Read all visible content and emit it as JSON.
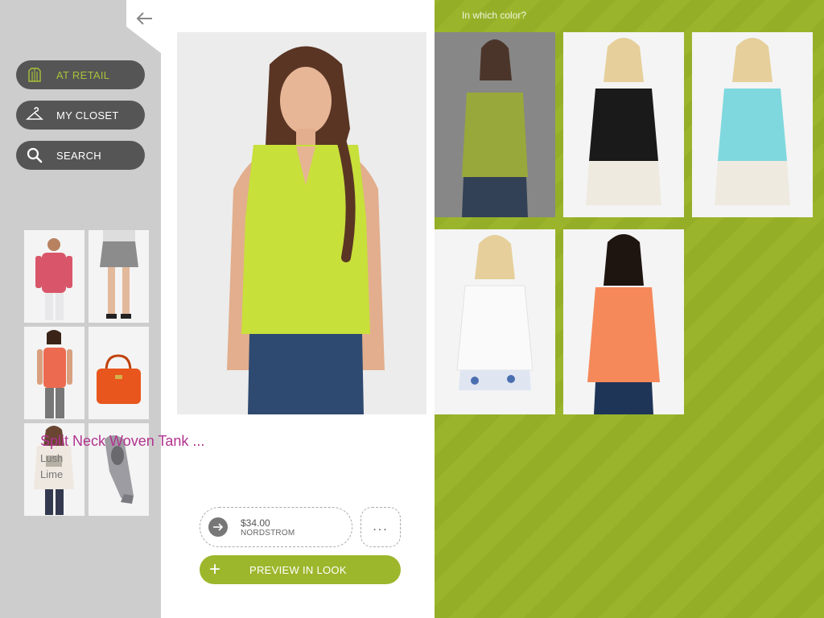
{
  "nav": {
    "back_icon": "arrow-left-icon",
    "items": [
      {
        "label": "AT RETAIL",
        "icon": "store-icon",
        "active": true
      },
      {
        "label": "MY CLOSET",
        "icon": "hanger-icon",
        "active": false
      },
      {
        "label": "SEARCH",
        "icon": "search-icon",
        "active": false
      }
    ]
  },
  "sidebar_thumbs": [
    {
      "item": "pink jacket",
      "color": "#d9566a"
    },
    {
      "item": "grey mini skirt",
      "color": "#8c8c8c"
    },
    {
      "item": "coral tank",
      "color": "#ec6a4f"
    },
    {
      "item": "orange handbag",
      "color": "#e8561d"
    },
    {
      "item": "white peasant blouse",
      "color": "#efe8e0"
    },
    {
      "item": "glitter wedge",
      "color": "#9c9ca2"
    }
  ],
  "product": {
    "title": "Split Neck Woven Tank ...",
    "brand": "Lush",
    "color": "Lime",
    "price": "$34.00",
    "store": "NORDSTROM",
    "more_label": "...",
    "preview_label": "PREVIEW IN LOOK",
    "hero_color": "#c8e03a"
  },
  "color_picker": {
    "title": "In which color?",
    "options": [
      {
        "name": "lime",
        "top": "#c5dd36",
        "bottom": "#2f4a70",
        "selected": true
      },
      {
        "name": "black",
        "top": "#1a1a1a",
        "bottom": "#eeeae0",
        "selected": false
      },
      {
        "name": "aqua",
        "top": "#7fd8de",
        "bottom": "#eeeae0",
        "selected": false
      },
      {
        "name": "white",
        "top": "#fafafa",
        "bottom": "#dfe6f2",
        "selected": false
      },
      {
        "name": "coral",
        "top": "#f5895a",
        "bottom": "#1f3558",
        "selected": false
      }
    ]
  },
  "colors": {
    "accent_green": "#9cb72c",
    "title_magenta": "#b2338f",
    "sidebar_grey": "#cdcdcd",
    "pill_dark": "#555555"
  }
}
